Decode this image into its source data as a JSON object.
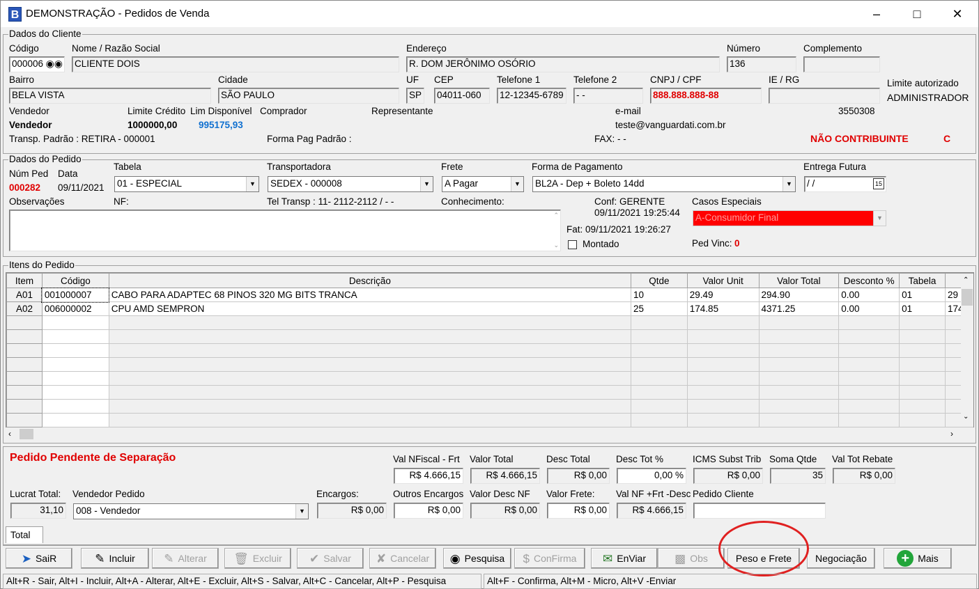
{
  "window": {
    "title": "DEMONSTRAÇÃO - Pedidos de Venda",
    "icon_letter": "B"
  },
  "cliente": {
    "group_label": "Dados do Cliente",
    "codigo_label": "Código",
    "codigo": "000006",
    "nome_label": "Nome / Razão Social",
    "nome": "CLIENTE DOIS",
    "endereco_label": "Endereço",
    "endereco": "R. DOM JERÔNIMO OSÓRIO",
    "numero_label": "Número",
    "numero": "136",
    "complemento_label": "Complemento",
    "complemento": "",
    "bairro_label": "Bairro",
    "bairro": "BELA VISTA",
    "cidade_label": "Cidade",
    "cidade": "SÃO PAULO",
    "uf_label": "UF",
    "uf": "SP",
    "cep_label": "CEP",
    "cep": "04011-060",
    "tel1_label": "Telefone 1",
    "tel1": "12-12345-6789",
    "tel2_label": "Telefone 2",
    "tel2": " -   -",
    "cnpj_label": "CNPJ / CPF",
    "cnpj": "888.888.888-88",
    "ie_label": "IE / RG",
    "ie": "",
    "limite_autorizado_label": "Limite autorizado",
    "limite_autorizado": "ADMINISTRADOR",
    "vendedor_label": "Vendedor",
    "vendedor": "Vendedor",
    "limite_credito_label": "Limite Crédito",
    "limite_credito": "1000000,00",
    "lim_disponivel_label": "Lim Disponível",
    "lim_disponivel": "995175,93",
    "comprador_label": "Comprador",
    "representante_label": "Representante",
    "email_label": "e-mail",
    "email": "teste@vanguardati.com.br",
    "codigo_ext": "3550308",
    "transp_padrao": "Transp. Padrão :   RETIRA - 000001",
    "forma_pag_padrao": "Forma Pag Padrão :",
    "fax": "FAX:      -   -",
    "contribuinte": "NÃO CONTRIBUINTE",
    "contribuinte_code": "C"
  },
  "pedido": {
    "group_label": "Dados do Pedido",
    "num_ped_label": "Núm Ped",
    "num_ped": "000282",
    "data_label": "Data",
    "data": "09/11/2021",
    "tabela_label": "Tabela",
    "tabela": "01 - ESPECIAL",
    "transportadora_label": "Transportadora",
    "transportadora": "SEDEX - 000008",
    "frete_label": "Frete",
    "frete": "A Pagar",
    "forma_pagamento_label": "Forma de Pagamento",
    "forma_pagamento": "BL2A - Dep + Boleto 14dd",
    "entrega_futura_label": "Entrega Futura",
    "entrega_futura": " / /",
    "observacoes_label": "Observações",
    "nf_label": "NF:",
    "tel_transp": "Tel Transp : 11- 2112-2112 /    -    -",
    "conhecimento_label": "Conhecimento:",
    "conf_label": "Conf: GERENTE",
    "conf_data": "09/11/2021 19:25:44",
    "fat": "Fat: 09/11/2021 19:26:27",
    "montado_label": "Montado",
    "casos_especiais_label": "Casos Especiais",
    "casos_especiais": "A-Consumidor Final",
    "ped_vinc_label": "Ped Vinc:",
    "ped_vinc": "0"
  },
  "itens": {
    "group_label": "Itens do Pedido",
    "columns": [
      "Item",
      "Código",
      "Descrição",
      "Qtde",
      "Valor Unit",
      "Valor Total",
      "Desconto %",
      "Tabela",
      ""
    ],
    "rows": [
      [
        "A01",
        "001000007",
        "CABO PARA ADAPTEC 68 PINOS 320 MG BITS TRANCA",
        "10",
        "29.49",
        "294.90",
        "0.00",
        "01",
        "29"
      ],
      [
        "A02",
        "006000002",
        "CPU AMD SEMPRON",
        "25",
        "174.85",
        "4371.25",
        "0.00",
        "01",
        "174"
      ]
    ]
  },
  "totais": {
    "status_msg": "Pedido Pendente de Separação",
    "val_nfiscal_label": "Val NFiscal - Frt",
    "val_nfiscal": "R$ 4.666,15",
    "valor_total_label": "Valor Total",
    "valor_total": "R$ 4.666,15",
    "desc_total_label": "Desc Total",
    "desc_total": "R$ 0,00",
    "desc_tot_pct_label": "Desc Tot %",
    "desc_tot_pct": "0,00 %",
    "icms_label": "ICMS Subst Trib",
    "icms": "R$ 0,00",
    "soma_qtde_label": "Soma Qtde",
    "soma_qtde": "35",
    "val_tot_rebate_label": "Val Tot Rebate",
    "val_tot_rebate": "R$ 0,00",
    "lucrat_total_label": "Lucrat Total:",
    "lucrat_total": "31,10",
    "vendedor_pedido_label": "Vendedor Pedido",
    "vendedor_pedido": "008 - Vendedor",
    "encargos_label": "Encargos:",
    "encargos": "R$ 0,00",
    "outros_encargos_label": "Outros Encargos",
    "outros_encargos": "R$ 0,00",
    "valor_desc_nf_label": "Valor Desc NF",
    "valor_desc_nf": "R$ 0,00",
    "valor_frete_label": "Valor Frete:",
    "valor_frete": "R$ 0,00",
    "val_nf_frt_label": "Val NF +Frt -Desc",
    "val_nf_frt": "R$ 4.666,15",
    "pedido_cliente_label": "Pedido Cliente",
    "pedido_cliente": "",
    "tab_total": "Total"
  },
  "toolbar": {
    "sair": "SaiR",
    "incluir": "Incluir",
    "alterar": "Alterar",
    "excluir": "Excluir",
    "salvar": "Salvar",
    "cancelar": "Cancelar",
    "pesquisa": "Pesquisa",
    "confirma": "ConFirma",
    "enviar": "EnViar",
    "obs": "Obs",
    "peso_frete": "Peso e Frete",
    "negociacao": "Negociação",
    "mais": "Mais"
  },
  "statusbar": {
    "left": "Alt+R - Sair, Alt+I - Incluir, Alt+A - Alterar, Alt+E - Excluir, Alt+S - Salvar, Alt+C - Cancelar, Alt+P - Pesquisa",
    "right": "Alt+F - Confirma, Alt+M - Micro, Alt+V -Enviar"
  },
  "colors": {
    "accent_red": "#e00000",
    "accent_blue": "#1070d0",
    "highlight_circle": "#e02020",
    "special_case_bg": "#ff0000"
  }
}
